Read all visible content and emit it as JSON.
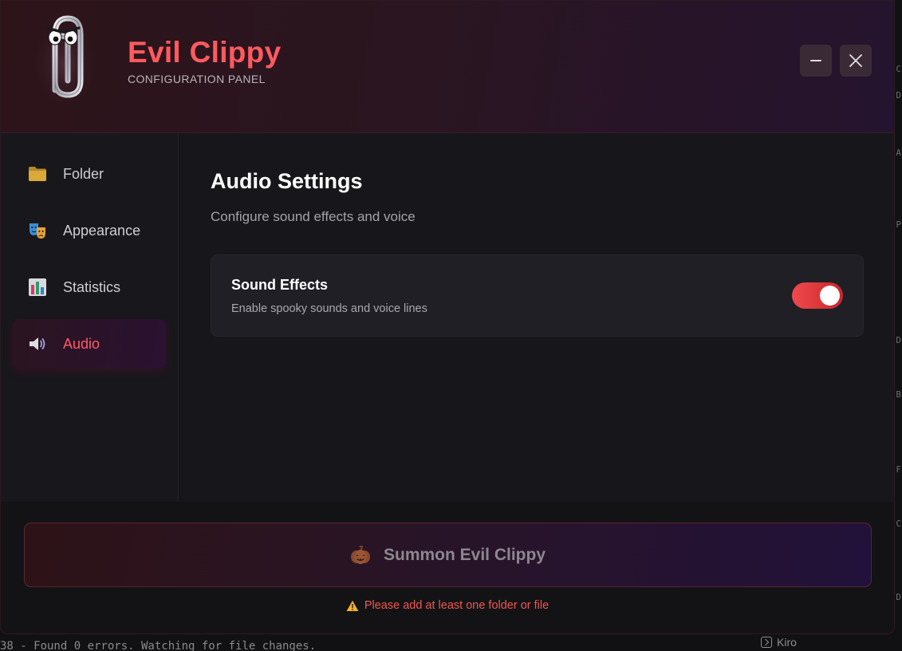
{
  "app": {
    "title": "Evil Clippy",
    "subtitle": "CONFIGURATION PANEL"
  },
  "window_controls": {
    "minimize_icon": "minimize-icon",
    "close_icon": "close-icon"
  },
  "sidebar": {
    "items": [
      {
        "label": "Folder",
        "icon": "folder-icon",
        "active": false
      },
      {
        "label": "Appearance",
        "icon": "theater-masks-icon",
        "active": false
      },
      {
        "label": "Statistics",
        "icon": "bar-chart-icon",
        "active": false
      },
      {
        "label": "Audio",
        "icon": "speaker-icon",
        "active": true
      }
    ]
  },
  "main": {
    "title": "Audio Settings",
    "subtitle": "Configure sound effects and voice",
    "settings": [
      {
        "title": "Sound Effects",
        "description": "Enable spooky sounds and voice lines",
        "enabled": true
      }
    ]
  },
  "footer": {
    "summon_label": "Summon Evil Clippy",
    "summon_icon": "pumpkin-icon",
    "warning_icon": "warning-icon",
    "warning_text": "Please add at least one folder or file"
  },
  "background": {
    "terminal_text": "38 - Found 0 errors. Watching for file changes.",
    "taskbar_label": "Kiro",
    "right_edge_chars": [
      "C",
      "D",
      "A",
      "P",
      "D",
      "B",
      "F",
      "C",
      "D"
    ]
  },
  "colors": {
    "accent": "#ff5a5f",
    "toggle_on": "#e8383e",
    "warning": "#f0564e"
  }
}
